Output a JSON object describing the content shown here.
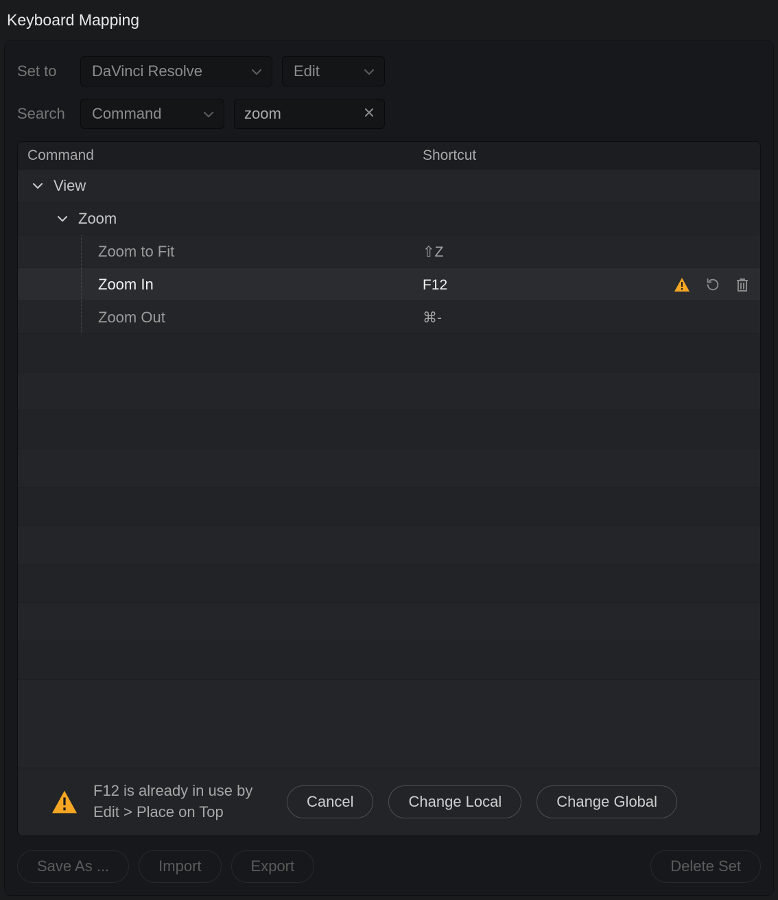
{
  "window": {
    "title": "Keyboard Mapping"
  },
  "controls": {
    "set_to_label": "Set to",
    "preset": "DaVinci Resolve",
    "context": "Edit",
    "search_label": "Search",
    "search_mode": "Command",
    "search_value": "zoom"
  },
  "columns": {
    "command": "Command",
    "shortcut": "Shortcut"
  },
  "tree": {
    "top": {
      "label": "View"
    },
    "group": {
      "label": "Zoom"
    },
    "items": [
      {
        "label": "Zoom to Fit",
        "shortcut": "⇧Z",
        "selected": false,
        "warning": false
      },
      {
        "label": "Zoom In",
        "shortcut": "F12",
        "selected": true,
        "warning": true
      },
      {
        "label": "Zoom Out",
        "shortcut": "⌘-",
        "selected": false,
        "warning": false
      }
    ]
  },
  "conflict": {
    "line1": "F12 is already in use by",
    "line2": "Edit > Place on Top",
    "cancel": "Cancel",
    "change_local": "Change Local",
    "change_global": "Change Global"
  },
  "footer": {
    "save_as": "Save As ...",
    "import": "Import",
    "export": "Export",
    "delete_set": "Delete Set"
  },
  "icons": {
    "chevron_down": "chevron-down-icon",
    "clear": "clear-icon",
    "warning": "warning-icon",
    "reset": "reset-icon",
    "trash": "trash-icon"
  }
}
